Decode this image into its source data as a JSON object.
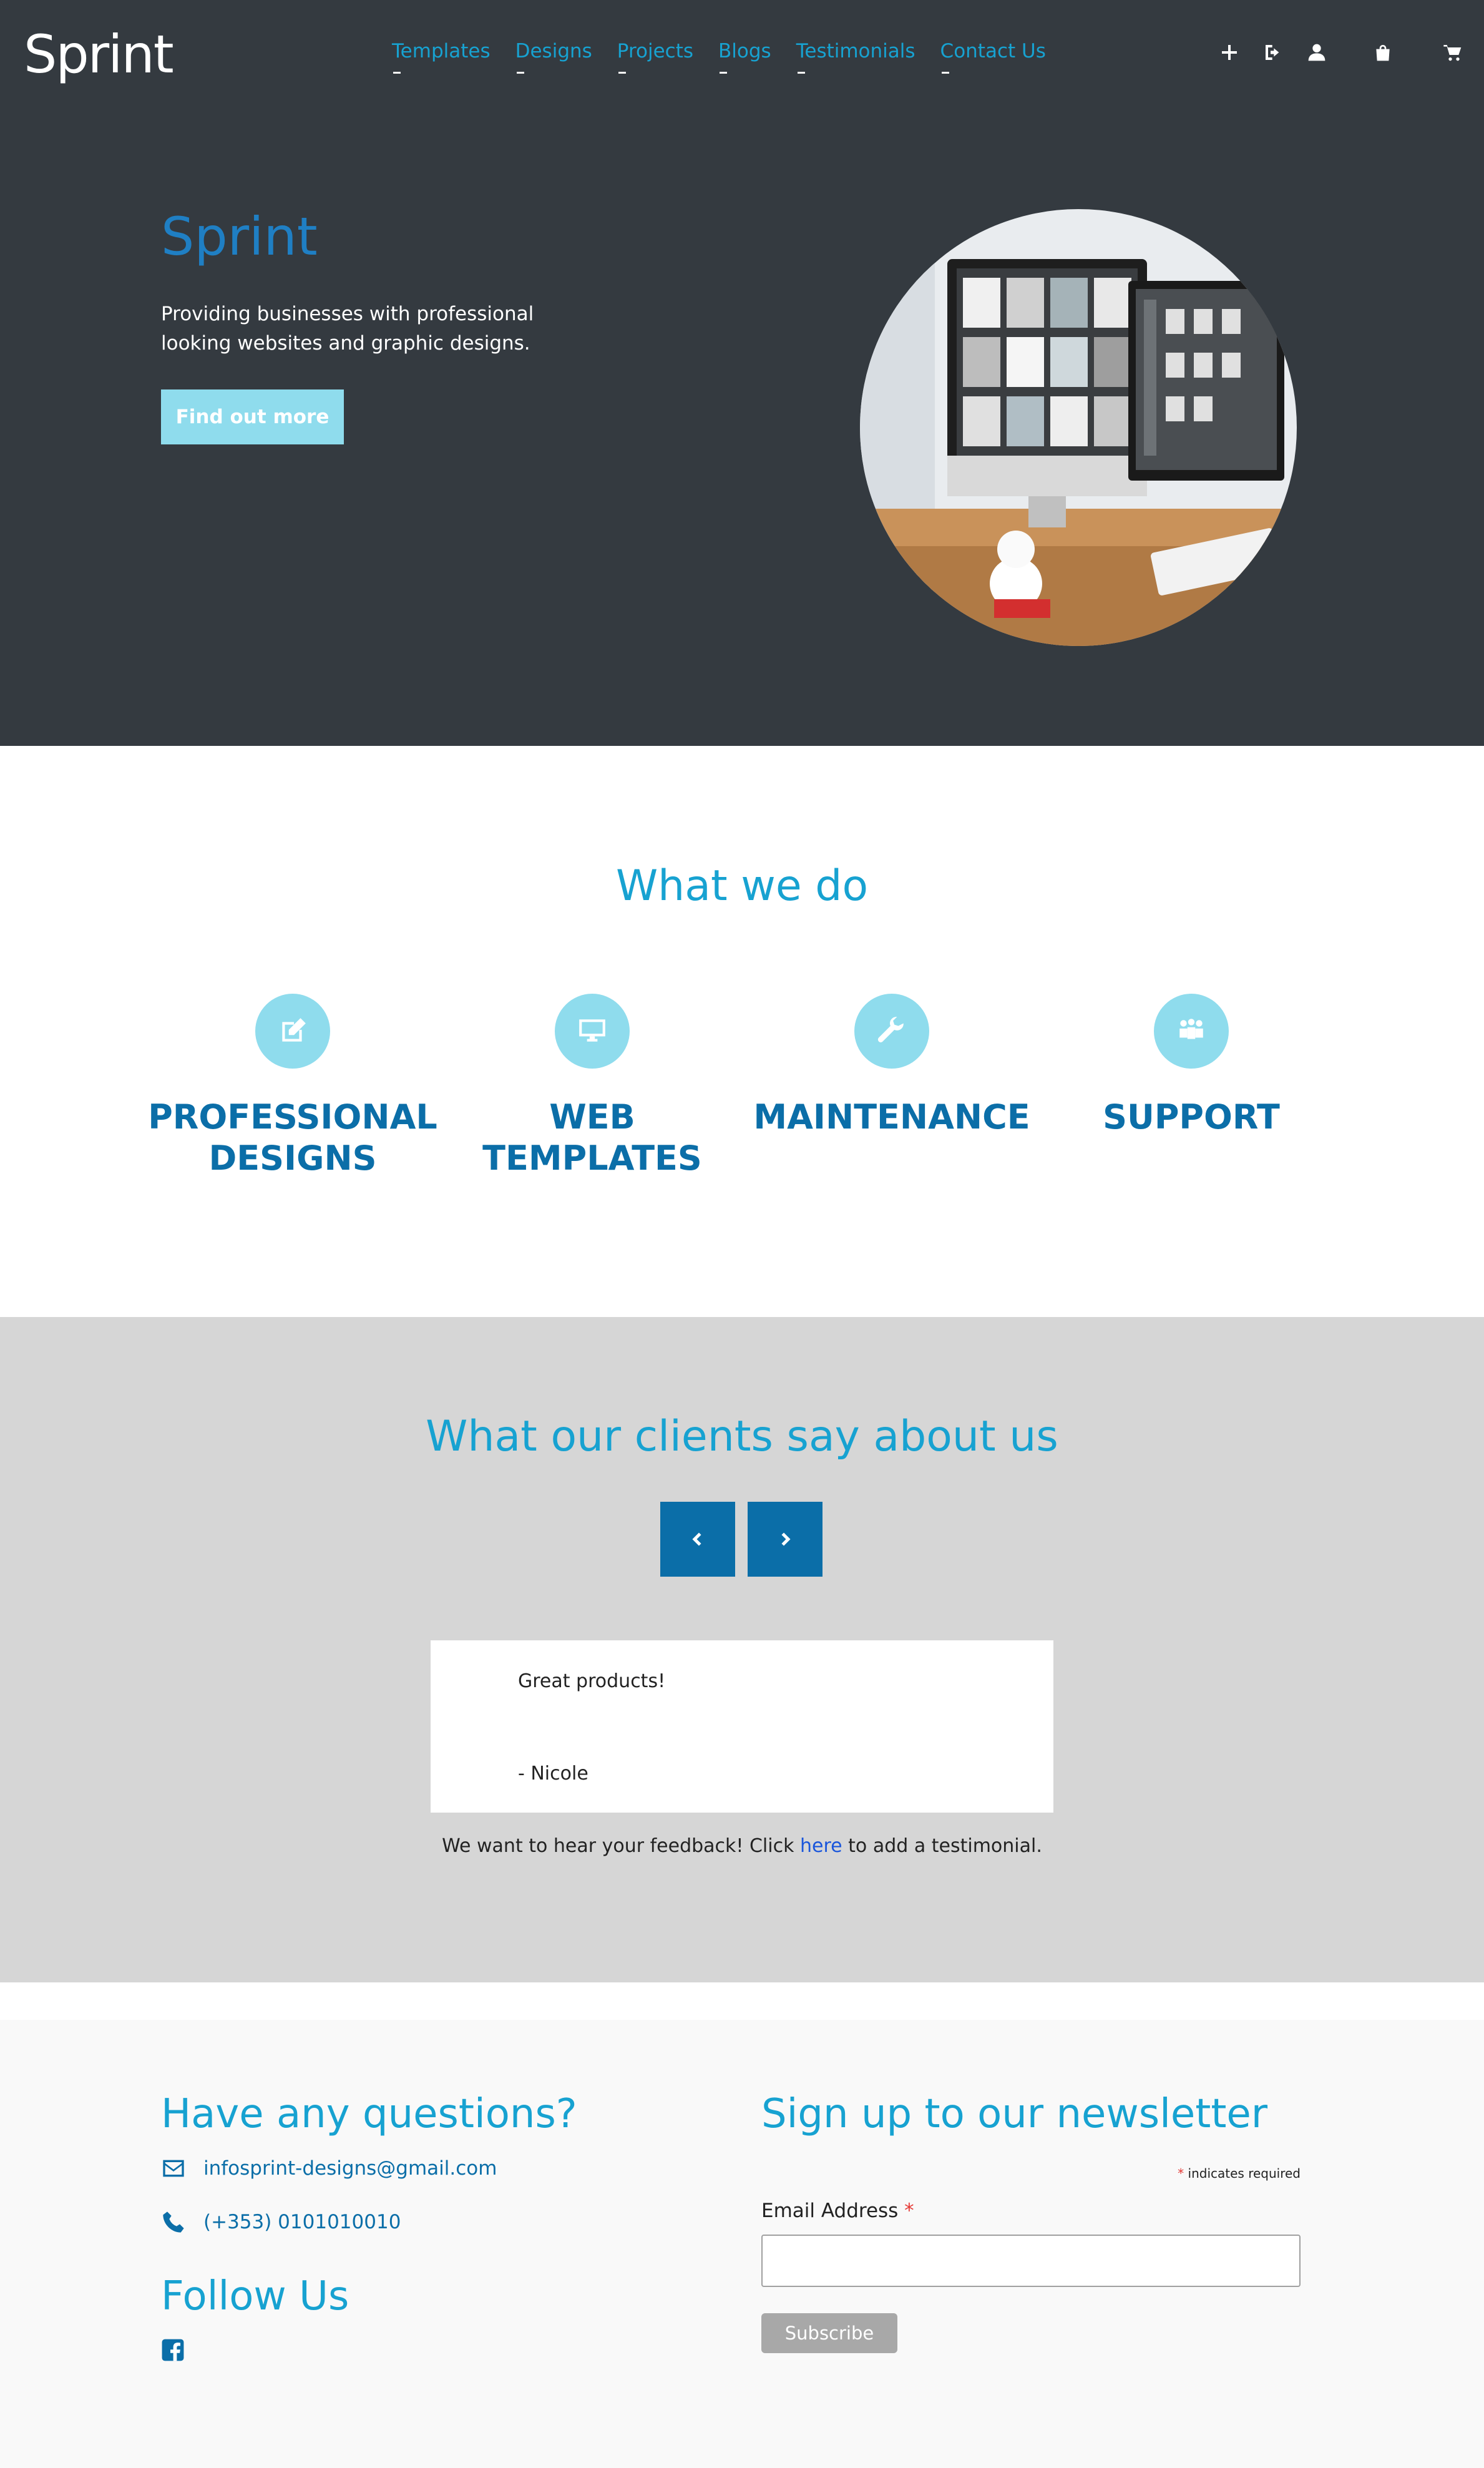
{
  "header": {
    "logo": "Sprint",
    "nav": [
      "Templates",
      "Designs",
      "Projects",
      "Blogs",
      "Testimonials",
      "Contact Us"
    ],
    "icons": [
      "plus-icon",
      "sign-in-icon",
      "user-icon",
      "shopping-bag-icon",
      "cart-icon"
    ]
  },
  "hero": {
    "title": "Sprint",
    "text": "Providing businesses with professional looking websites and graphic designs.",
    "button": "Find out more"
  },
  "services": {
    "title": "What we do",
    "items": [
      {
        "label": "Professional Designs",
        "icon": "edit-icon"
      },
      {
        "label": "Web Templates",
        "icon": "monitor-icon"
      },
      {
        "label": "Maintenance",
        "icon": "wrench-icon"
      },
      {
        "label": "Support",
        "icon": "people-icon"
      }
    ]
  },
  "testimonials": {
    "title": "What our clients say about us",
    "quote": "Great products!",
    "author": "- Nicole",
    "feedback_before": "We want to hear your feedback! Click ",
    "feedback_link": "here",
    "feedback_after": " to add a testimonial."
  },
  "footer": {
    "questions_title": "Have any questions?",
    "email": "infosprint-designs@gmail.com",
    "phone": "(+353) 0101010010",
    "follow_title": "Follow Us",
    "newsletter_title": "Sign up to our newsletter",
    "required_star": "*",
    "required_note": " indicates required",
    "email_label": "Email Address ",
    "email_star": "*",
    "subscribe": "Subscribe"
  },
  "colors": {
    "dark_bg": "#343a40",
    "accent": "#17a2d1",
    "primary": "#0b6ea8",
    "light_accent": "#8fdced",
    "gray_bg": "#d6d6d6"
  }
}
